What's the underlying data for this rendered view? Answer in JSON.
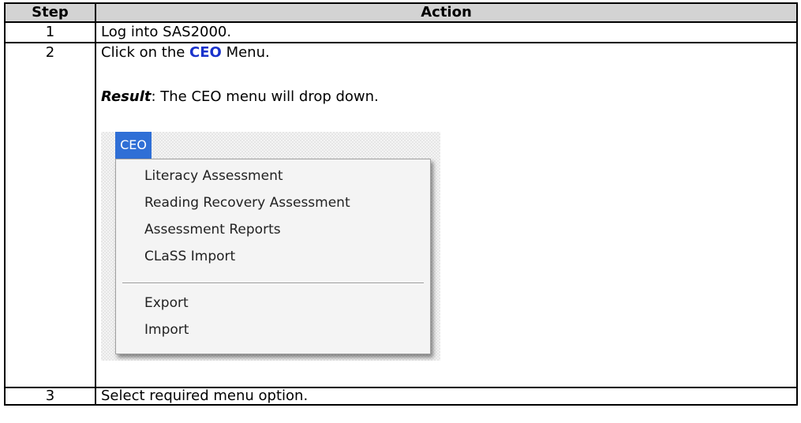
{
  "table": {
    "headers": {
      "step": "Step",
      "action": "Action"
    },
    "rows": [
      {
        "step": "1",
        "action": "Log into SAS2000."
      },
      {
        "step": "2",
        "action_prefix": "Click on the ",
        "action_command": "CEO",
        "action_suffix": " Menu.",
        "result_label": "Result",
        "result_text": ": The CEO menu will drop down."
      },
      {
        "step": "3",
        "action": "Select required menu option."
      }
    ]
  },
  "menu_screenshot": {
    "tab_label": "CEO",
    "items_group1": [
      "Literacy Assessment",
      "Reading Recovery Assessment",
      "Assessment Reports",
      "CLaSS Import"
    ],
    "items_group2": [
      "Export",
      "Import"
    ],
    "colors": {
      "tab_background": "#2f6fd6",
      "command_text": "#1a33cc",
      "header_background": "#d3d3d3"
    }
  }
}
